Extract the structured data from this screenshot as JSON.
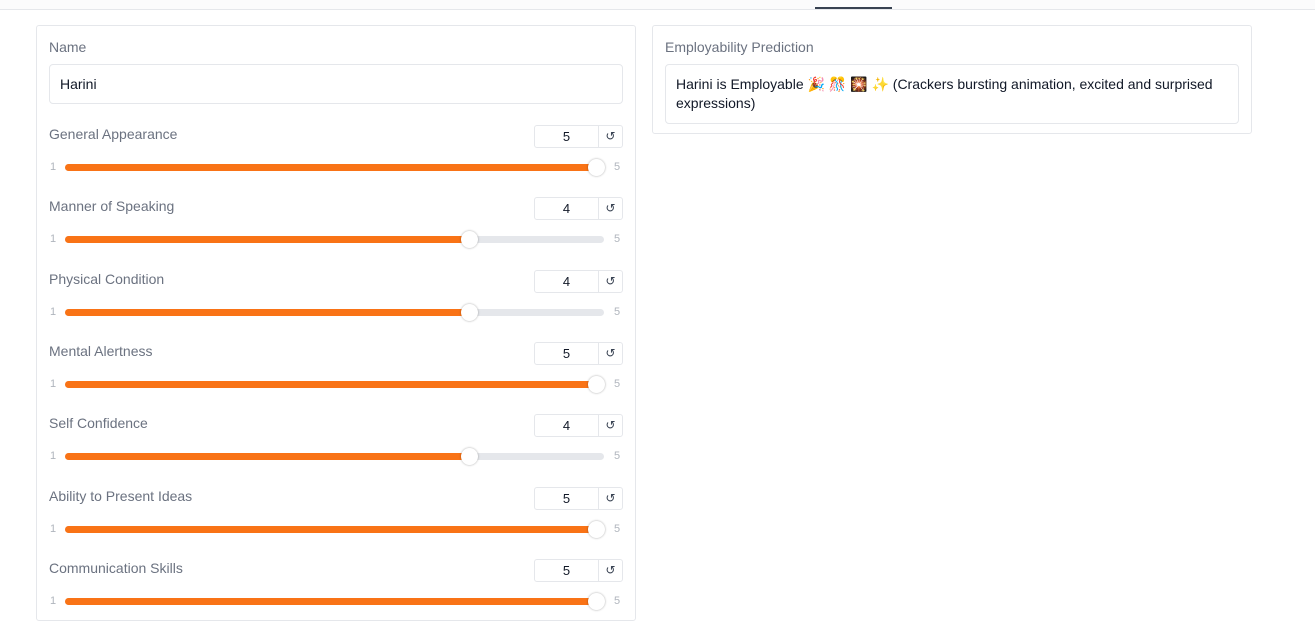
{
  "name_field": {
    "label": "Name",
    "value": "Harini"
  },
  "prediction": {
    "label": "Employability Prediction",
    "text": "Harini is Employable 🎉 🎊 🎇 ✨ (Crackers bursting animation, excited and surprised expressions)"
  },
  "sliders": [
    {
      "label": "General Appearance",
      "value": 5,
      "min": 1,
      "max": 5
    },
    {
      "label": "Manner of Speaking",
      "value": 4,
      "min": 1,
      "max": 5
    },
    {
      "label": "Physical Condition",
      "value": 4,
      "min": 1,
      "max": 5
    },
    {
      "label": "Mental Alertness",
      "value": 5,
      "min": 1,
      "max": 5
    },
    {
      "label": "Self Confidence",
      "value": 4,
      "min": 1,
      "max": 5
    },
    {
      "label": "Ability to Present Ideas",
      "value": 5,
      "min": 1,
      "max": 5
    },
    {
      "label": "Communication Skills",
      "value": 5,
      "min": 1,
      "max": 5
    }
  ],
  "reset_icon": "↺",
  "colors": {
    "accent": "#f97316",
    "track": "#e5e7eb",
    "tab_indicator": "#374151"
  }
}
